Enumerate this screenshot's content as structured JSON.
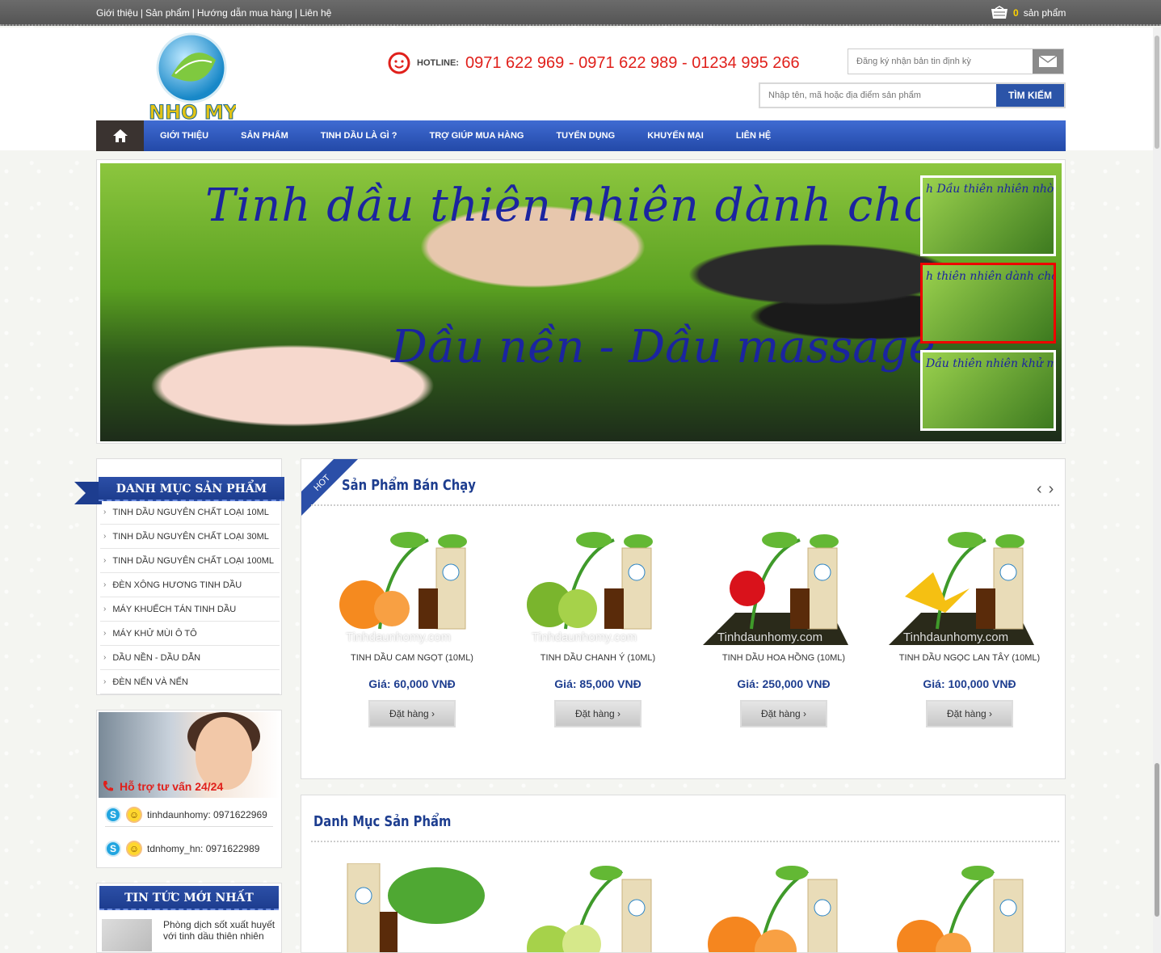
{
  "topbar": {
    "links": [
      "Giới thiệu",
      "Sản phẩm",
      "Hướng dẫn mua hàng",
      "Liên hệ"
    ],
    "cart_count": "0",
    "cart_label": "sản phẩm"
  },
  "header": {
    "logo_text": "NHO MY",
    "hotline_label": "HOTLINE:",
    "hotline_numbers": "0971 622 969 - 0971 622 989 - 01234 995 266",
    "newsletter_placeholder": "Đăng ký nhận bản tin định kỳ",
    "search_placeholder": "Nhập tên, mã hoặc địa điểm sản phẩm",
    "search_button": "TÌM KIẾM"
  },
  "nav": {
    "items": [
      "GIỚI THIỆU",
      "SẢN PHẨM",
      "TINH DẦU LÀ GÌ ?",
      "TRỢ GIÚP MUA HÀNG",
      "TUYỂN DỤNG",
      "KHUYẾN MẠI",
      "LIÊN HỆ"
    ]
  },
  "banner": {
    "title_line1": "Tinh dầu thiên nhiên dành cho spa",
    "title_line2": "Dầu nền - Dầu massage",
    "thumbs": [
      "h Dầu thiên nhiên nhờn",
      "h thiên nhiên dành cho",
      "Dầu thiên nhiên khử mùi"
    ]
  },
  "sidebar": {
    "category_title": "DANH MỤC SẢN PHẨM",
    "categories": [
      "TINH DẦU NGUYÊN CHẤT LOẠI 10ML",
      "TINH DẦU NGUYÊN CHẤT LOẠI 30ML",
      "TINH DẦU NGUYÊN CHẤT LOẠI 100ML",
      "ĐÈN XÔNG HƯƠNG TINH DẦU",
      "MÁY KHUẾCH TÁN TINH DẦU",
      "MÁY KHỬ MÙI Ô TÔ",
      "DẦU NỀN - DẦU DẪN",
      "ĐÈN NẾN VÀ NẾN"
    ],
    "support_label": "Hỗ trợ tư vấn 24/24",
    "support_contacts": [
      "tinhdaunhomy: 0971622969",
      "tdnhomy_hn: 0971622989"
    ],
    "news_title": "TIN TỨC MỚI NHẤT",
    "news_item": "Phòng dịch sốt xuất huyết với tinh dầu thiên nhiên"
  },
  "best_sellers": {
    "hot_tag": "HOT",
    "title": "Sản Phẩm Bán Chạy",
    "watermark": "Tinhdaunhomy.com",
    "products": [
      {
        "name": "TINH DẦU CAM NGỌT (10ML)",
        "price": "Giá: 60,000 VNĐ",
        "button": "Đặt hàng",
        "color": "#f58a1f"
      },
      {
        "name": "TINH DẦU CHANH Ý (10ML)",
        "price": "Giá: 85,000 VNĐ",
        "button": "Đặt hàng",
        "color": "#8cc63e"
      },
      {
        "name": "TINH DẦU HOA HỒNG (10ML)",
        "price": "Giá: 250,000 VNĐ",
        "button": "Đặt hàng",
        "color": "#d9121b"
      },
      {
        "name": "TINH DẦU NGỌC LAN TÂY (10ML)",
        "price": "Giá: 100,000 VNĐ",
        "button": "Đặt hàng",
        "color": "#f5c012"
      }
    ]
  },
  "category_section": {
    "title": "Danh Mục Sản Phẩm",
    "product_colors": [
      "#4fa833",
      "#a6d24a",
      "#f5861f",
      "#f5861f"
    ]
  },
  "colors": {
    "nav_blue": "#2b54a8",
    "hotline_red": "#e0201b",
    "price_blue": "#1d3d8f"
  }
}
